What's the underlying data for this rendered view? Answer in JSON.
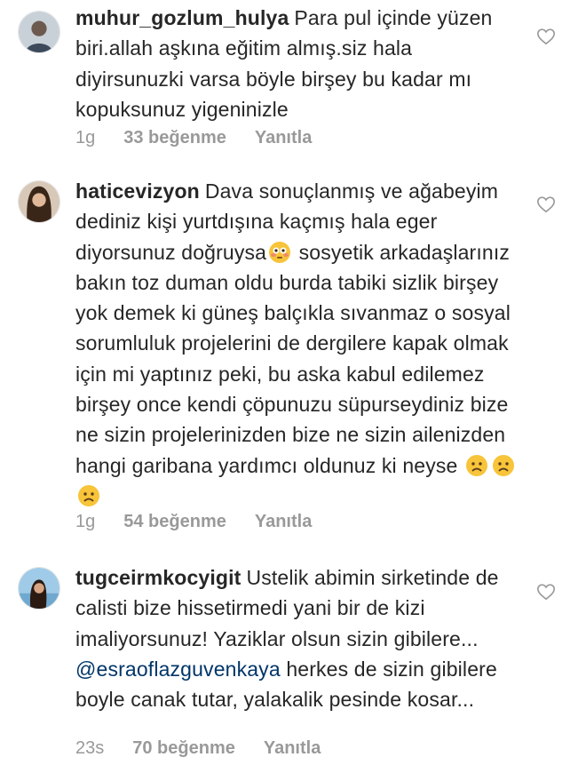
{
  "comments": [
    {
      "username": "muhur_gozlum_hulya",
      "text": "Para pul içinde yüzen biri.allah aşkına eğitim almış.siz hala diyirsunuzki varsa böyle birşey bu kadar mı kopuksunuz yigeninizle",
      "time": "1g",
      "likes": "33 beğenme",
      "reply": "Yanıtla",
      "avatar_icon": "user-avatar-icon"
    },
    {
      "username": "haticevizyon",
      "text_before_emoji": "Dava sonuçlanmış ve ağabeyim dediniz kişi yurtdışına kaçmış hala eger diyorsunuz doğruysa",
      "text_after_emoji": "sosyetik arkadaşlarınız bakın toz duman oldu burda tabiki sizlik birşey yok demek ki güneş balçıkla sıvanmaz o sosyal sorumluluk projelerini de dergilere kapak olmak için mi yaptınız peki, bu aska kabul edilemez birşey once kendi çöpunuzu süpurseydiniz bize ne sizin projelerinizden bize ne sizin ailenizden hangi garibana yardımcı oldunuz ki neyse",
      "emoji_flushed": "flushed-face-emoji",
      "emoji_worried": "worried-face-emoji",
      "time": "1g",
      "likes": "54 beğenme",
      "reply": "Yanıtla",
      "avatar_icon": "user-avatar-icon"
    },
    {
      "username": "tugceirmkocyigit",
      "text_before_mention": "Ustelik abimin sirketinde de calisti  bize hissetirmedi yani bir de kizi imaliyorsunuz! Yaziklar olsun sizin gibilere...",
      "mention": "@esraoflazguvenkaya",
      "text_after_mention": "herkes de sizin gibilere boyle canak tutar, yalakalik pesinde kosar...",
      "time": "23s",
      "likes": "70 beğenme",
      "reply": "Yanıtla",
      "avatar_icon": "user-avatar-icon"
    }
  ],
  "colors": {
    "text": "#262626",
    "meta": "#999999",
    "mention": "#003569"
  },
  "icons": {
    "like": "heart-icon"
  }
}
